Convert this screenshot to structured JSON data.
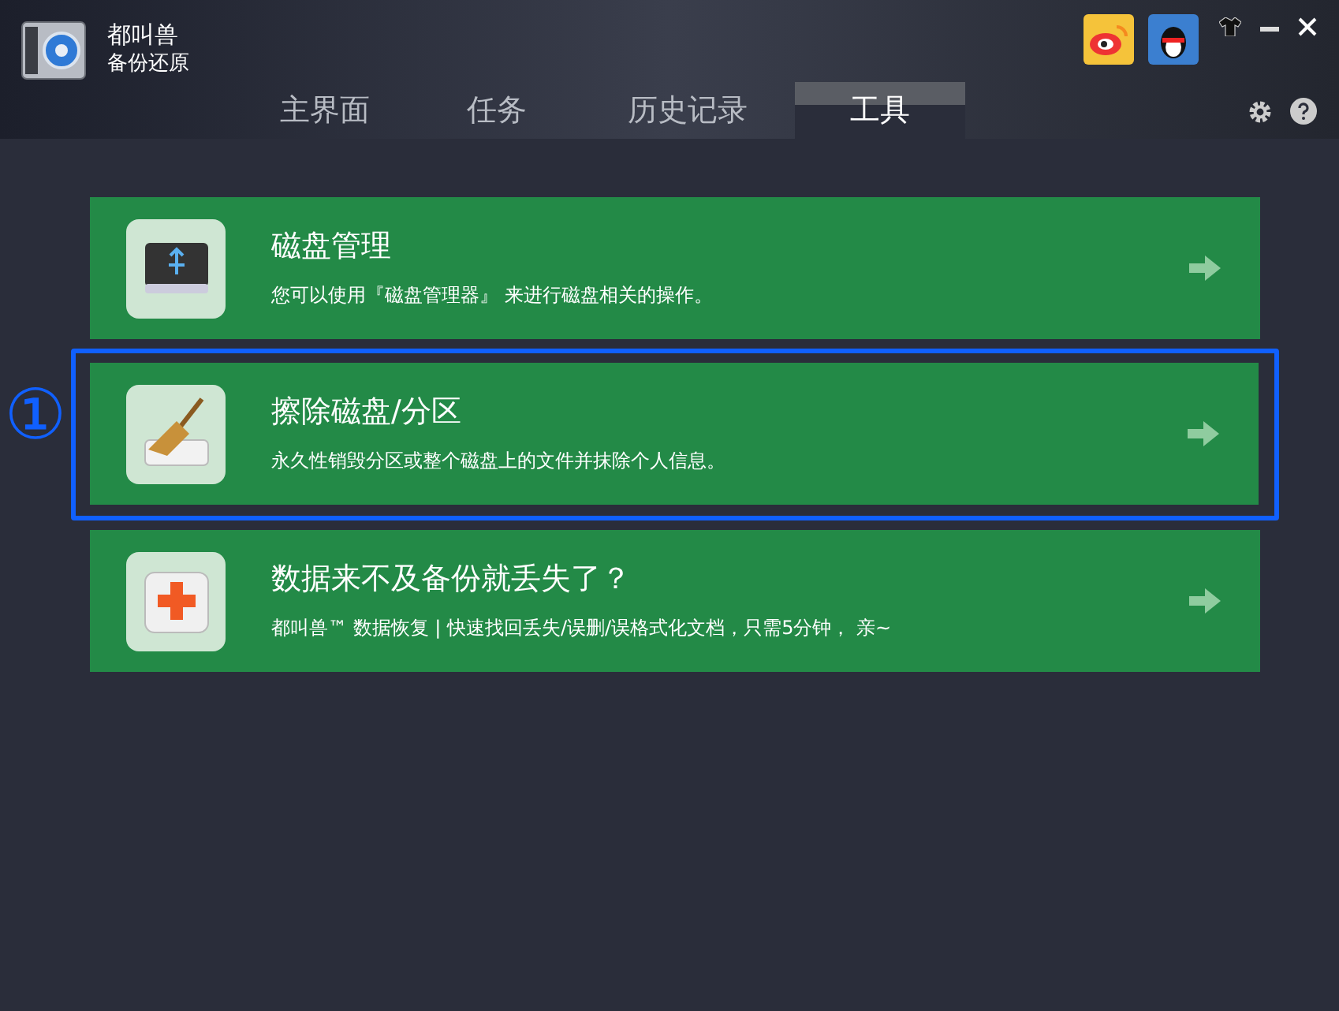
{
  "app": {
    "name_line1": "都叫兽",
    "name_line2": "备份还原"
  },
  "tabs": [
    {
      "label": "主界面",
      "selected": false
    },
    {
      "label": "任务",
      "selected": false
    },
    {
      "label": "历史记录",
      "selected": false
    },
    {
      "label": "工具",
      "selected": true
    }
  ],
  "tools": [
    {
      "kind": "disk",
      "title": "磁盘管理",
      "description": "您可以使用『磁盘管理器』 来进行磁盘相关的操作。",
      "highlighted": false
    },
    {
      "kind": "erase",
      "title": "擦除磁盘/分区",
      "description": "永久性销毁分区或整个磁盘上的文件并抹除个人信息。",
      "highlighted": true
    },
    {
      "kind": "recover",
      "title": "数据来不及备份就丢失了？",
      "description": "都叫兽™ 数据恢复 | 快速找回丢失/误删/误格式化文档，只需5分钟， 亲~",
      "highlighted": false
    }
  ],
  "annotation": {
    "marker": "①"
  }
}
